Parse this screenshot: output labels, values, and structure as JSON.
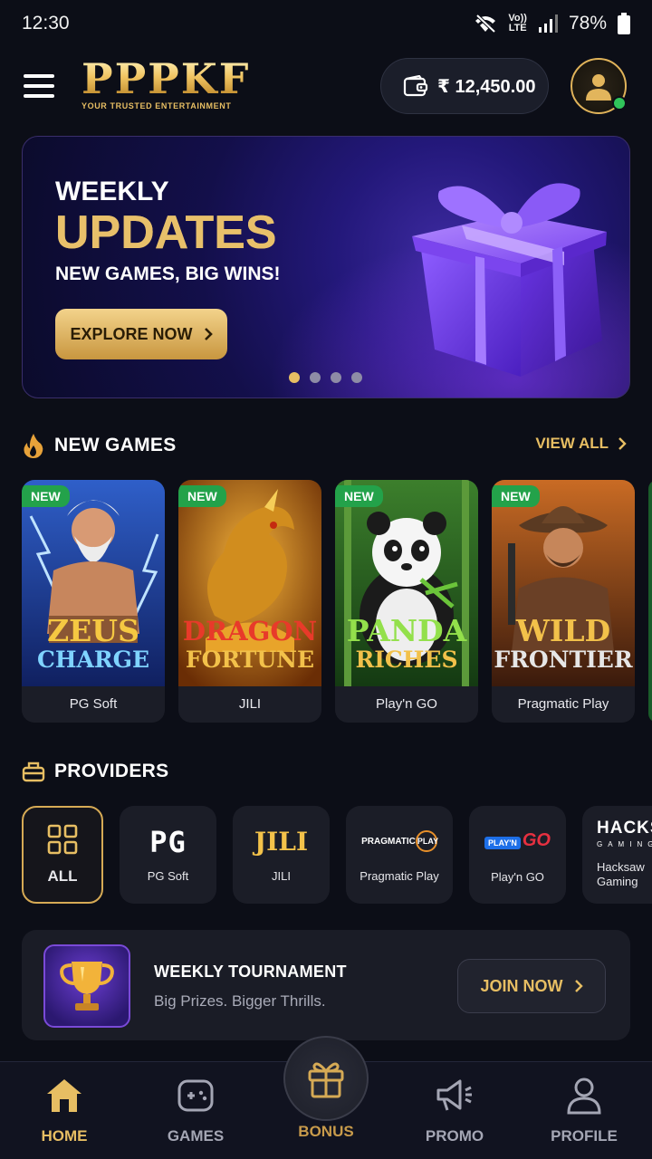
{
  "status_bar": {
    "time": "12:30",
    "network_top": "Vo))",
    "network_bottom": "LTE",
    "battery": "78%"
  },
  "header": {
    "logo_title": "PPPKF",
    "logo_subtitle": "YOUR TRUSTED ENTERTAINMENT",
    "wallet_amount": "₹ 12,450.00",
    "icons": [
      "menu-icon",
      "wallet-icon",
      "user-icon"
    ]
  },
  "banner": {
    "line1": "WEEKLY",
    "line2": "UPDATES",
    "line3": "NEW GAMES, BIG WINS!",
    "cta": "EXPLORE NOW",
    "active_slide": 1,
    "slide_count": 4
  },
  "new_games": {
    "title": "NEW GAMES",
    "view_all": "VIEW ALL",
    "items": [
      {
        "badge": "NEW",
        "name_l1": "ZEUS",
        "name_l2": "CHARGE",
        "provider": "PG Soft"
      },
      {
        "badge": "NEW",
        "name_l1": "DRAGON",
        "name_l2": "FORTUNE",
        "provider": "JILI"
      },
      {
        "badge": "NEW",
        "name_l1": "PANDA",
        "name_l2": "RICHES",
        "provider": "Play'n GO"
      },
      {
        "badge": "NEW",
        "name_l1": "WILD",
        "name_l2": "FRONTIER",
        "provider": "Pragmatic Play"
      }
    ]
  },
  "providers": {
    "title": "PROVIDERS",
    "items": [
      {
        "label": "ALL"
      },
      {
        "label": "PG Soft",
        "logo_text": "PG"
      },
      {
        "label": "JILI",
        "logo_text": "JILI"
      },
      {
        "label": "Pragmatic Play",
        "logo_text": "PRAGMATIC",
        "logo_text_2": "PLAY"
      },
      {
        "label": "Play'n GO",
        "logo_text": "PLAY'N",
        "logo_text_2": "GO"
      },
      {
        "label": "Hacksaw Gaming",
        "logo_text": "HACKSAW",
        "logo_text_2": "GAMING"
      }
    ]
  },
  "tournament": {
    "title": "WEEKLY TOURNAMENT",
    "subtitle": "Big Prizes. Bigger Thrills.",
    "cta": "JOIN NOW"
  },
  "bottom_nav": {
    "items": [
      {
        "label": "HOME",
        "icon": "home-icon",
        "active": true
      },
      {
        "label": "GAMES",
        "icon": "gamepad-icon"
      },
      {
        "label": "BONUS",
        "icon": "gift-icon"
      },
      {
        "label": "PROMO",
        "icon": "megaphone-icon"
      },
      {
        "label": "PROFILE",
        "icon": "user-icon"
      }
    ]
  },
  "colors": {
    "background": "#0c0e17",
    "accent_gold": "#e7be63",
    "new_badge": "#23a24a",
    "online": "#30c45a"
  }
}
